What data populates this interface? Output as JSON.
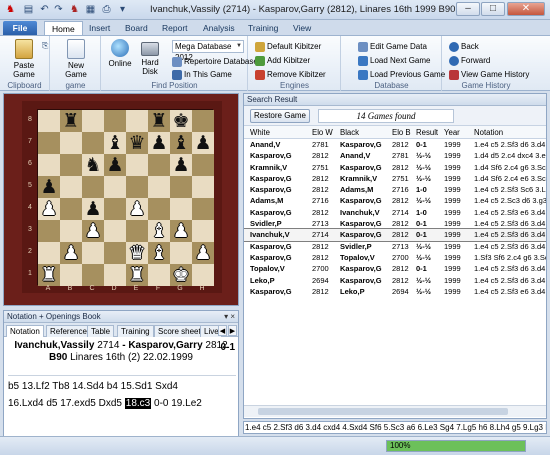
{
  "window": {
    "title": "Ivanchuk,Vassily (2714) - Kasparov,Garry (2812), Linares 16th 1999  B90, 0-1",
    "controls": [
      "–",
      "□",
      "✕"
    ]
  },
  "ribbon": {
    "tabs": [
      "File",
      "Home",
      "Insert",
      "Board",
      "Report",
      "Analysis",
      "Training",
      "View"
    ],
    "active_tab": "Home",
    "clipboard": {
      "paste_label": "Paste Game",
      "group": "Clipboard"
    },
    "game": {
      "new_game_label": "New Game",
      "group": "game"
    },
    "find": {
      "online_label": "Online",
      "hard_disk_label": "Hard Disk",
      "database": "Mega Database 2012",
      "repertoire_label": "Repertoire Database",
      "in_this_game_label": "In This Game",
      "group": "Find Position"
    },
    "engines": {
      "default_label": "Default Kibitzer",
      "add_label": "Add Kibitzer",
      "remove_label": "Remove Kibitzer",
      "group": "Engines"
    },
    "database": {
      "edit_label": "Edit Game Data",
      "next_label": "Load Next Game",
      "previous_label": "Load Previous Game",
      "group": "Database"
    },
    "history": {
      "back_label": "Back",
      "forward_label": "Forward",
      "view_label": "View Game History",
      "group": "Game History"
    }
  },
  "board": {
    "files": [
      "A",
      "B",
      "C",
      "D",
      "E",
      "F",
      "G",
      "H"
    ],
    "ranks": [
      "8",
      "7",
      "6",
      "5",
      "4",
      "3",
      "2",
      "1"
    ],
    "position": [
      [
        "",
        "bR",
        "",
        "",
        "",
        "bR",
        "bK",
        ""
      ],
      [
        "",
        "",
        "",
        "bB",
        "bQ",
        "bP",
        "bB",
        "bP"
      ],
      [
        "",
        "",
        "bN",
        "bP",
        "",
        "",
        "bP",
        ""
      ],
      [
        "bP",
        "",
        "",
        "",
        "",
        "",
        "",
        ""
      ],
      [
        "wP",
        "",
        "bP",
        "",
        "wP",
        "",
        "",
        ""
      ],
      [
        "",
        "",
        "wP",
        "",
        "",
        "wB",
        "wP",
        ""
      ],
      [
        "",
        "wP",
        "",
        "",
        "wQ",
        "wB",
        "",
        "wP"
      ],
      [
        "wR",
        "",
        "",
        "",
        "wR",
        "",
        "wK",
        ""
      ]
    ]
  },
  "notation": {
    "panel_title": "Notation + Openings Book",
    "tabs": [
      "Notation",
      "Reference",
      "Table",
      "Training",
      "Score sheet",
      "Live"
    ],
    "white": "Ivanchuk,Vassily",
    "white_elo": "2714",
    "black": "Kasparov,Garry",
    "black_elo": "2812",
    "result": "0-1",
    "eco": "B90",
    "event": "Linares 16th (2) 22.02.1999",
    "moves_line1": "b5 13.Lf2 Tb8 14.Sd4 b4 15.Sd1 Sxd4",
    "moves_line2_pre": "16.Lxd4 d5 17.exd5 Dxd5",
    "moves_current": "18.c3",
    "moves_line2_post": "0-0 19.Le2"
  },
  "results": {
    "panel_title": "Search Result",
    "restore_label": "Restore Game",
    "found_text": "14 Games found",
    "columns": [
      "White",
      "Elo W",
      "Black",
      "Elo B",
      "Result",
      "Year",
      "Notation"
    ],
    "rows": [
      [
        "Anand,V",
        "2781",
        "Kasparov,G",
        "2812",
        "0-1",
        "1999",
        "1.e4 c5 2.Sf3 d6 3.d4"
      ],
      [
        "Kasparov,G",
        "2812",
        "Anand,V",
        "2781",
        "½-½",
        "1999",
        "1.d4 d5 2.c4 dxc4 3.e"
      ],
      [
        "Kramnik,V",
        "2751",
        "Kasparov,G",
        "2812",
        "½-½",
        "1999",
        "1.d4 Sf6 2.c4 g6 3.Sc"
      ],
      [
        "Kasparov,G",
        "2812",
        "Kramnik,V",
        "2751",
        "½-½",
        "1999",
        "1.d4 Sf6 2.c4 e6 3.Sc"
      ],
      [
        "Kasparov,G",
        "2812",
        "Adams,M",
        "2716",
        "1-0",
        "1999",
        "1.e4 c5 2.Sf3 Sc6 3.Lb"
      ],
      [
        "Adams,M",
        "2716",
        "Kasparov,G",
        "2812",
        "½-½",
        "1999",
        "1.e4 c5 2.Sc3 d6 3.g3"
      ],
      [
        "Kasparov,G",
        "2812",
        "Ivanchuk,V",
        "2714",
        "1-0",
        "1999",
        "1.e4 c5 2.Sf3 e6 3.d4"
      ],
      [
        "Svidler,P",
        "2713",
        "Kasparov,G",
        "2812",
        "0-1",
        "1999",
        "1.e4 c5 2.Sf3 d6 3.d4"
      ],
      [
        "Ivanchuk,V",
        "2714",
        "Kasparov,G",
        "2812",
        "0-1",
        "1999",
        "1.e4 c5 2.Sf3 d6 3.d4"
      ],
      [
        "Kasparov,G",
        "2812",
        "Svidler,P",
        "2713",
        "½-½",
        "1999",
        "1.e4 c5 2.Sf3 d6 3.d4"
      ],
      [
        "Kasparov,G",
        "2812",
        "Topalov,V",
        "2700",
        "½-½",
        "1999",
        "1.Sf3 Sf6 2.c4 g6 3.Sc"
      ],
      [
        "Topalov,V",
        "2700",
        "Kasparov,G",
        "2812",
        "0-1",
        "1999",
        "1.e4 c5 2.Sf3 d6 3.d4"
      ],
      [
        "Leko,P",
        "2694",
        "Kasparov,G",
        "2812",
        "½-½",
        "1999",
        "1.e4 c5 2.Sf3 d6 3.d4"
      ],
      [
        "Kasparov,G",
        "2812",
        "Leko,P",
        "2694",
        "½-½",
        "1999",
        "1.e4 c5 2.Sf3 e6 3.d4"
      ]
    ],
    "selected_row": 8
  },
  "move_line": "1.e4 c5 2.Sf3 d6 3.d4 cxd4 4.Sxd4 Sf6 5.Sc3 a6 6.Le3 Sg4 7.Lg5 h6 8.Lh4 g5 9.Lg3 Lg7 10.H",
  "status": {
    "progress_text": "100%",
    "progress": 1.0,
    "accent": "#6cc05a"
  }
}
